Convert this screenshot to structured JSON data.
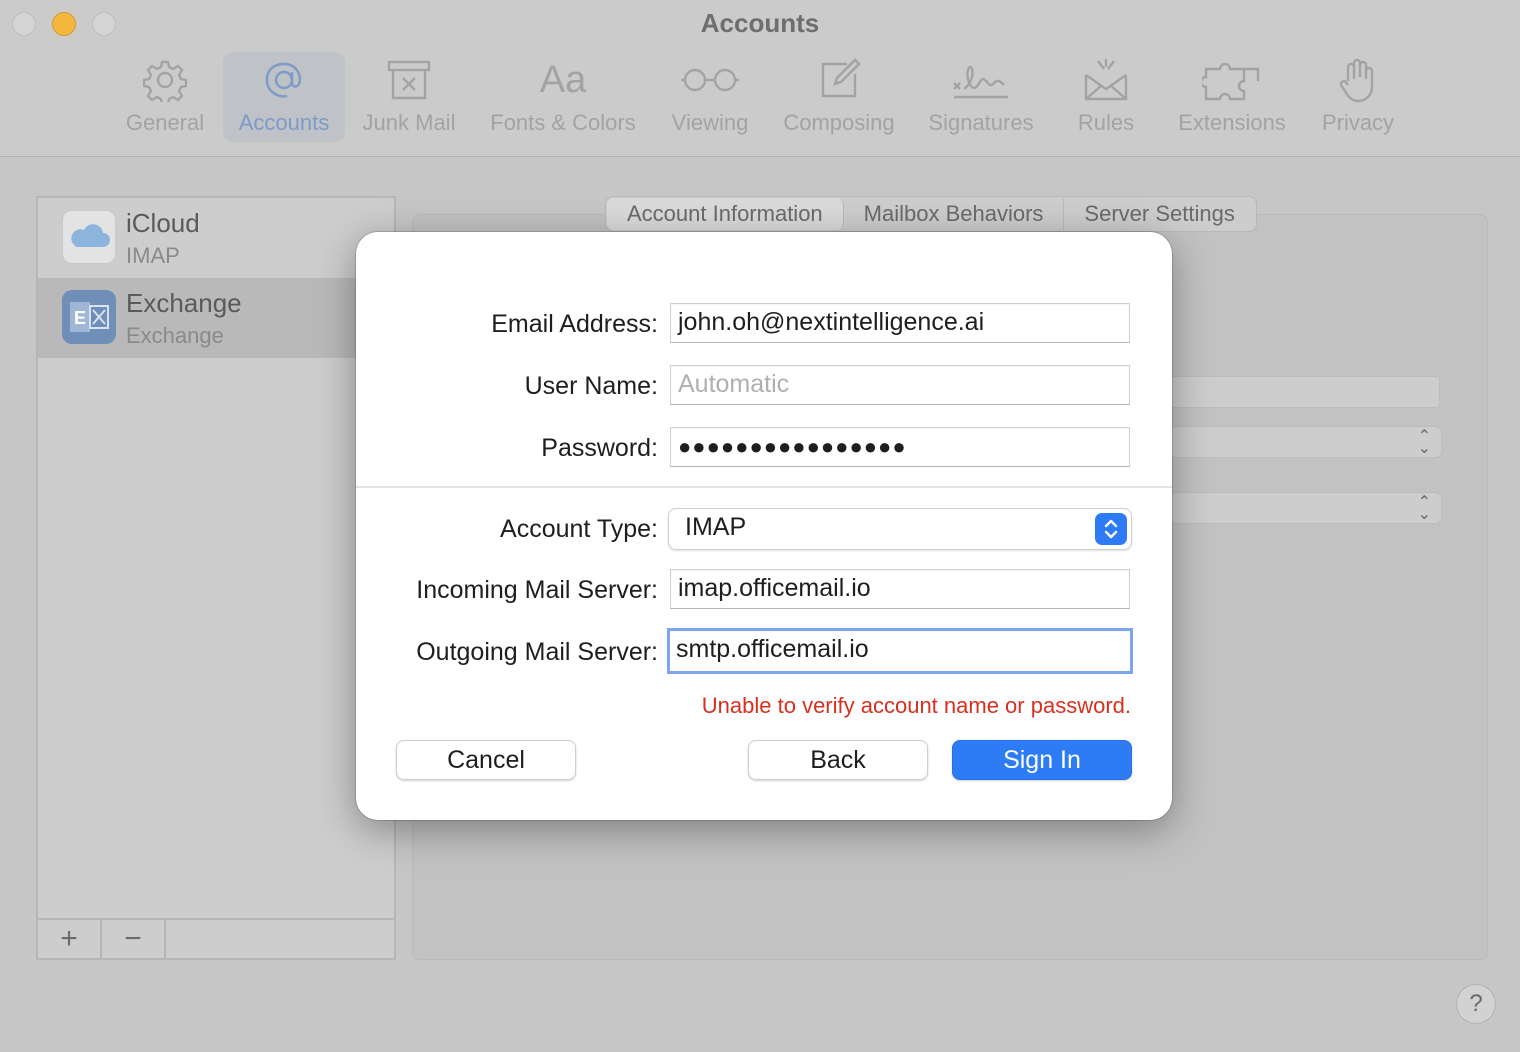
{
  "window": {
    "title": "Accounts"
  },
  "toolbar": {
    "items": [
      {
        "label": "General",
        "icon": "gear-icon"
      },
      {
        "label": "Accounts",
        "icon": "at-icon",
        "active": true
      },
      {
        "label": "Junk Mail",
        "icon": "junk-mail-icon"
      },
      {
        "label": "Fonts & Colors",
        "icon": "fonts-icon"
      },
      {
        "label": "Viewing",
        "icon": "glasses-icon"
      },
      {
        "label": "Composing",
        "icon": "compose-icon"
      },
      {
        "label": "Signatures",
        "icon": "signature-icon"
      },
      {
        "label": "Rules",
        "icon": "rules-icon"
      },
      {
        "label": "Extensions",
        "icon": "puzzle-icon"
      },
      {
        "label": "Privacy",
        "icon": "hand-icon"
      }
    ],
    "fonts_glyph": "Aa"
  },
  "accounts": [
    {
      "name": "iCloud",
      "type": "IMAP",
      "icon": "icloud-icon"
    },
    {
      "name": "Exchange",
      "type": "Exchange",
      "icon": "exchange-icon",
      "selected": true
    }
  ],
  "list_footer": {
    "add": "+",
    "remove": "−"
  },
  "tabs": [
    {
      "label": "Account Information",
      "active": true
    },
    {
      "label": "Mailbox Behaviors"
    },
    {
      "label": "Server Settings"
    }
  ],
  "dialog": {
    "email_label": "Email Address:",
    "email_value": "john.oh@nextintelligence.ai",
    "username_label": "User Name:",
    "username_placeholder": "Automatic",
    "password_label": "Password:",
    "password_value": "●●●●●●●●●●●●●●●●",
    "account_type_label": "Account Type:",
    "account_type_value": "IMAP",
    "incoming_label": "Incoming Mail Server:",
    "incoming_value": "imap.officemail.io",
    "outgoing_label": "Outgoing Mail Server:",
    "outgoing_value": "smtp.officemail.io",
    "error": "Unable to verify account name or password.",
    "cancel": "Cancel",
    "back": "Back",
    "sign_in": "Sign In"
  },
  "help": "?",
  "colors": {
    "accent": "#2d7cf6",
    "error": "#d8301e",
    "focus_ring": "#7da5ec"
  }
}
